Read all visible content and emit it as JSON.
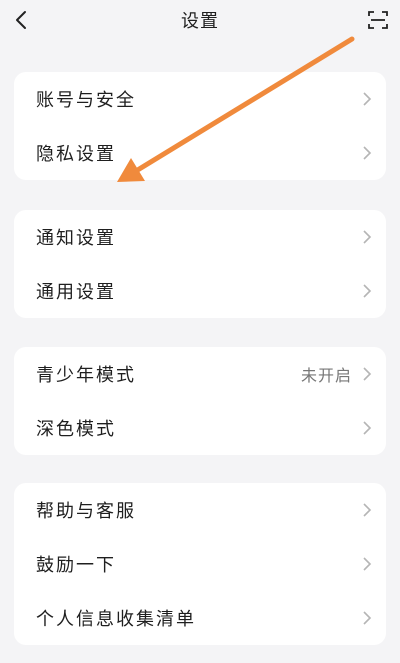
{
  "header": {
    "title": "设置",
    "back_icon": "chevron-left-icon",
    "scan_icon": "scan-icon"
  },
  "groups": [
    {
      "items": [
        {
          "label": "账号与安全"
        },
        {
          "label": "隐私设置"
        }
      ]
    },
    {
      "items": [
        {
          "label": "通知设置"
        },
        {
          "label": "通用设置"
        }
      ]
    },
    {
      "items": [
        {
          "label": "青少年模式",
          "value": "未开启"
        },
        {
          "label": "深色模式"
        }
      ]
    },
    {
      "items": [
        {
          "label": "帮助与客服"
        },
        {
          "label": "鼓励一下"
        },
        {
          "label": "个人信息收集清单"
        }
      ]
    }
  ],
  "annotation": {
    "arrow_color": "#f08a3c",
    "points_to": "隐私设置"
  },
  "colors": {
    "background": "#f4f4f6",
    "card": "#ffffff",
    "text": "#1f1f1f",
    "muted": "#777777"
  }
}
